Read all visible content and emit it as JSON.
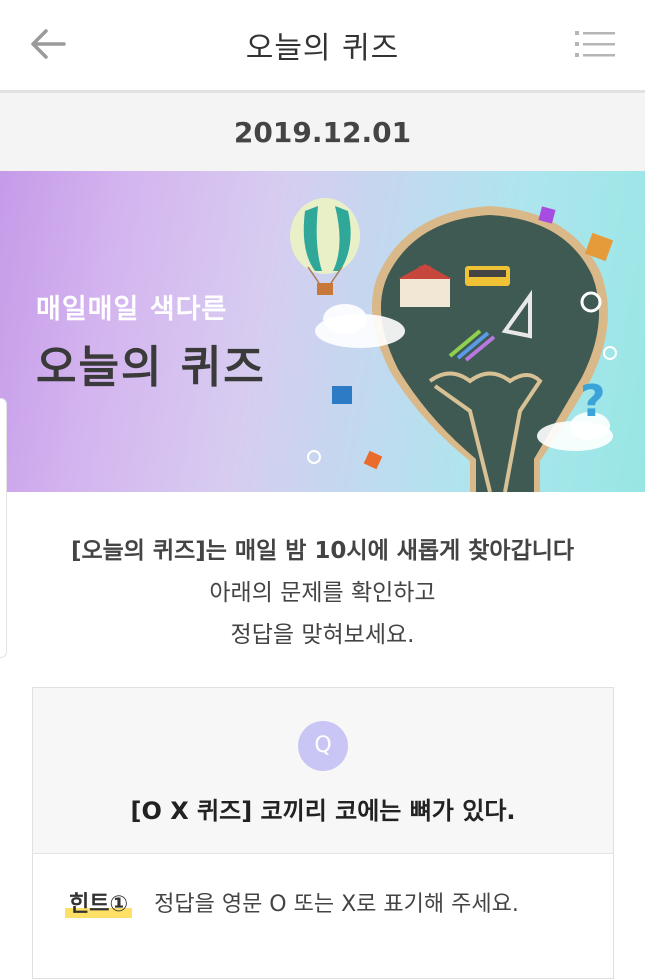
{
  "header": {
    "title": "오늘의 퀴즈",
    "back_icon": "arrow-left-icon",
    "menu_icon": "menu-icon"
  },
  "date": "2019.12.01",
  "banner": {
    "subtitle": "매일매일 색다른",
    "title": "오늘의 퀴즈"
  },
  "intro": {
    "line1_bold": "[오늘의 퀴즈]는 매일 밤 10시에 새롭게 찾아갑니다",
    "line2": "아래의 문제를 확인하고",
    "line3": "정답을 맞혀보세요."
  },
  "question": {
    "badge": "Q",
    "text": "[O X 퀴즈] 코끼리 코에는 뼈가 있다.",
    "hint_label": "힌트①",
    "hint_text": "정답을 영문 O 또는 X로 표기해 주세요."
  },
  "colors": {
    "accent_badge": "#c9c6f5",
    "hint_highlight": "#ffe066"
  }
}
